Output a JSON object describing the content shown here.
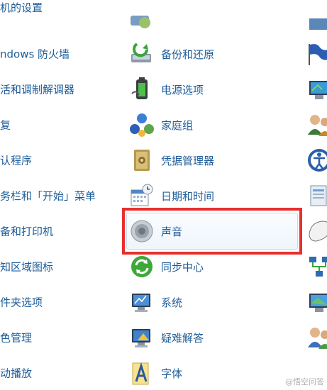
{
  "header": {
    "title_fragment": "机的设置"
  },
  "left_items": [
    {
      "label": "ndows 防火墙"
    },
    {
      "label": "活和调制解调器"
    },
    {
      "label": "复"
    },
    {
      "label": "认程序"
    },
    {
      "label": "务栏和「开始」菜单"
    },
    {
      "label": "备和打印机"
    },
    {
      "label": "知区域图标"
    },
    {
      "label": "件夹选项"
    },
    {
      "label": "色管理"
    },
    {
      "label": "动播放"
    }
  ],
  "middle_items": [
    {
      "label": "备份和还原",
      "icon": "backup-restore-icon"
    },
    {
      "label": "电源选项",
      "icon": "power-options-icon"
    },
    {
      "label": "家庭组",
      "icon": "homegroup-icon"
    },
    {
      "label": "凭据管理器",
      "icon": "credential-manager-icon"
    },
    {
      "label": "日期和时间",
      "icon": "date-time-icon"
    },
    {
      "label": "声音",
      "icon": "speaker-icon"
    },
    {
      "label": "同步中心",
      "icon": "sync-center-icon"
    },
    {
      "label": "系统",
      "icon": "system-icon"
    },
    {
      "label": "疑难解答",
      "icon": "troubleshooting-icon"
    },
    {
      "label": "字体",
      "icon": "fonts-icon"
    }
  ],
  "selected_item": "声音",
  "highlight_color": "#e6302f",
  "watermark": "@悟空问答"
}
